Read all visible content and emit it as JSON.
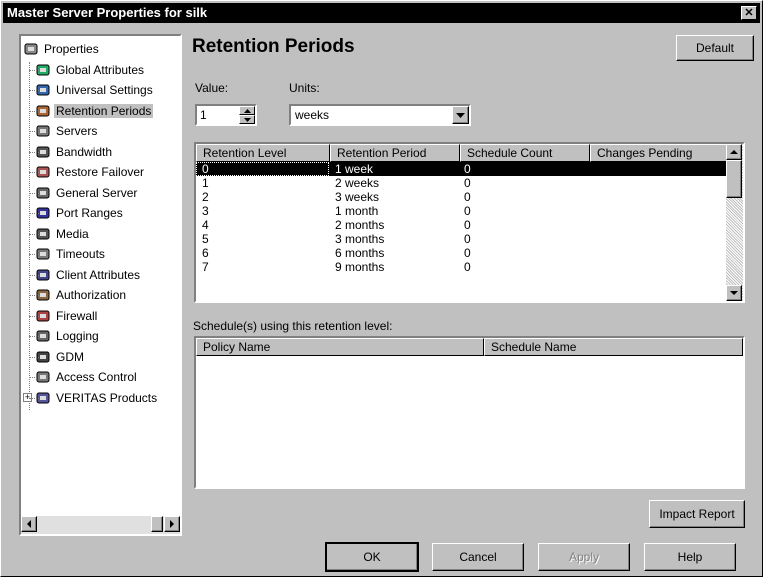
{
  "window": {
    "title": "Master Server Properties for silk",
    "close_glyph": "✕"
  },
  "tree": {
    "items": [
      {
        "label": "Properties",
        "icon": "properties-icon"
      },
      {
        "label": "Global Attributes",
        "icon": "globe-icon"
      },
      {
        "label": "Universal Settings",
        "icon": "network-icon"
      },
      {
        "label": "Retention Periods",
        "icon": "retention-clock-icon"
      },
      {
        "label": "Servers",
        "icon": "server-icon"
      },
      {
        "label": "Bandwidth",
        "icon": "bandwidth-icon"
      },
      {
        "label": "Restore Failover",
        "icon": "failover-icon"
      },
      {
        "label": "General Server",
        "icon": "server-icon"
      },
      {
        "label": "Port Ranges",
        "icon": "port-icon"
      },
      {
        "label": "Media",
        "icon": "media-icon"
      },
      {
        "label": "Timeouts",
        "icon": "timer-icon"
      },
      {
        "label": "Client Attributes",
        "icon": "client-icon"
      },
      {
        "label": "Authorization",
        "icon": "user-icon"
      },
      {
        "label": "Firewall",
        "icon": "firewall-icon"
      },
      {
        "label": "Logging",
        "icon": "log-icon"
      },
      {
        "label": "GDM",
        "icon": "gdm-icon"
      },
      {
        "label": "Access Control",
        "icon": "lock-icon"
      },
      {
        "label": "VERITAS Products",
        "icon": "veritas-icon"
      }
    ]
  },
  "panel": {
    "heading": "Retention Periods",
    "default_button": "Default",
    "value_label": "Value:",
    "units_label": "Units:",
    "value": "1",
    "units": "weeks"
  },
  "retention_table": {
    "columns": [
      "Retention Level",
      "Retention Period",
      "Schedule Count",
      "Changes Pending"
    ],
    "rows": [
      [
        "0",
        "1 week",
        "0",
        ""
      ],
      [
        "1",
        "2 weeks",
        "0",
        ""
      ],
      [
        "2",
        "3 weeks",
        "0",
        ""
      ],
      [
        "3",
        "1 month",
        "0",
        ""
      ],
      [
        "4",
        "2 months",
        "0",
        ""
      ],
      [
        "5",
        "3 months",
        "0",
        ""
      ],
      [
        "6",
        "6 months",
        "0",
        ""
      ],
      [
        "7",
        "9 months",
        "0",
        ""
      ]
    ]
  },
  "schedules": {
    "label": "Schedule(s) using this retention level:",
    "columns": [
      "Policy Name",
      "Schedule Name"
    ]
  },
  "impact_button": "Impact Report",
  "buttons": {
    "ok": "OK",
    "cancel": "Cancel",
    "apply": "Apply",
    "help": "Help"
  }
}
